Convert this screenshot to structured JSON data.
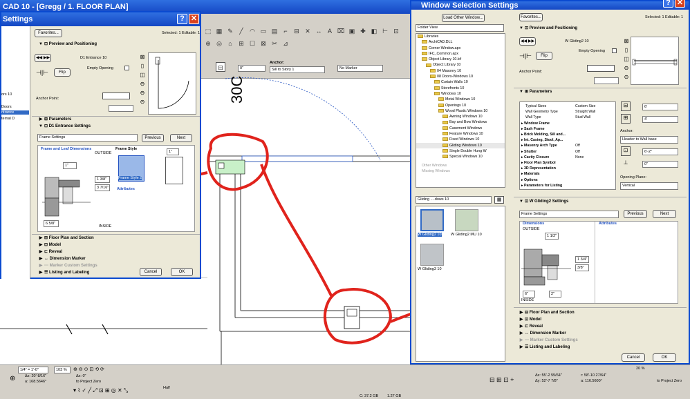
{
  "app": {
    "title": "CAD 10 - [Gregg / 1. FLOOR PLAN]"
  },
  "canvas": {
    "dimension_text": "30C"
  },
  "toolbar": {
    "anchor_label": "Anchor:",
    "anchor_value": "Sill to Story 1",
    "offset_value": "0\"",
    "marker_value": "No Marker"
  },
  "left_dialog": {
    "title": "Settings",
    "favorites": "Favorites...",
    "selected": "Selected: 1 Editable: 1",
    "preview_section": "Preview and Positioning",
    "object_name": "D1 Entrance 10",
    "empty_opening": "Empty Opening",
    "flip": "Flip",
    "anchor_point": "Anchor Point:",
    "parameters": "Parameters",
    "settings_section": "D1 Entrance Settings",
    "frame_settings": "Frame Settings",
    "previous": "Previous",
    "next": "Next",
    "frame_leaf_dims": "Frame and Leaf Dimensions",
    "outside": "OUTSIDE",
    "inside": "INSIDE",
    "frame_style": "Frame Style",
    "frame_style_value": "Frame Style 2",
    "attributes": "Attributes",
    "dims": {
      "d1": "1\"",
      "d2": "1 3/8\"",
      "d3": "3 7/16\"",
      "d4": "6 5/8\"",
      "d5": "1\""
    },
    "sections": [
      "Floor Plan and Section",
      "Model",
      "Reveal",
      "Dimension Marker",
      "Marker Custom Settings",
      "Listing and Labeling"
    ],
    "cancel": "Cancel",
    "ok": "OK",
    "sidebar": [
      "ors 10",
      "Doors",
      "ntrance",
      "ternal D"
    ]
  },
  "right_dialog": {
    "title": "Window Selection Settings",
    "favorites": "Favorites...",
    "selected": "Selected: 1 Editable: 1",
    "load_other": "Load Other Window...",
    "folder_view": "Folder View",
    "tree": [
      {
        "label": "Libraries",
        "depth": 0
      },
      {
        "label": "ArchiCAD.DLL",
        "depth": 1
      },
      {
        "label": "Corner Window.apx",
        "depth": 1
      },
      {
        "label": "IFC_Common.apx",
        "depth": 1
      },
      {
        "label": "Object Library 10.lcf",
        "depth": 1
      },
      {
        "label": "Object Library 10",
        "depth": 2
      },
      {
        "label": "04 Masonry 10",
        "depth": 3
      },
      {
        "label": "08 Doors-Windows 10",
        "depth": 3
      },
      {
        "label": "Curtain Walls 10",
        "depth": 4
      },
      {
        "label": "Storefronts 10",
        "depth": 4
      },
      {
        "label": "Windows 10",
        "depth": 4
      },
      {
        "label": "Metal Windows 10",
        "depth": 5
      },
      {
        "label": "Openings 10",
        "depth": 5
      },
      {
        "label": "Wood Plastic Windows 10",
        "depth": 5
      },
      {
        "label": "Awning Windows 10",
        "depth": 6
      },
      {
        "label": "Bay and Bow Windows",
        "depth": 6
      },
      {
        "label": "Casement Windows",
        "depth": 6
      },
      {
        "label": "Feature Windows 10",
        "depth": 6
      },
      {
        "label": "Fixed Windows 10",
        "depth": 6
      },
      {
        "label": "Gliding Windows 10",
        "depth": 6
      },
      {
        "label": "Single Double Hung W",
        "depth": 6
      },
      {
        "label": "Special Windows 10",
        "depth": 6
      }
    ],
    "other_windows": "Other Windows",
    "missing_windows": "Missing Windows",
    "gallery_folder": "Gliding ....dows 10",
    "thumbs": [
      "W Gliding2 10",
      "W Gliding2 MU 10",
      "W Gliding3 10"
    ],
    "preview_section": "Preview and Positioning",
    "object_name": "W Gliding2 10",
    "empty_opening": "Empty Opening",
    "flip": "Flip",
    "anchor_point": "Anchor Point:",
    "parameters_section": "Parameters",
    "params": [
      {
        "k": "Typical Sizes",
        "v": "Custom Size"
      },
      {
        "k": "Wall Geometry Type",
        "v": "Straight Wall"
      },
      {
        "k": "Wall Type",
        "v": "Stud Wall"
      },
      {
        "k": "Window Frame",
        "v": "",
        "b": true
      },
      {
        "k": "Sash Frame",
        "v": "",
        "b": true
      },
      {
        "k": "Brick Molding, Sill and...",
        "v": "",
        "b": true
      },
      {
        "k": "Int. Casing, Stool, Ap...",
        "v": "",
        "b": true
      },
      {
        "k": "Masonry Arch Type",
        "v": "Off",
        "b": true
      },
      {
        "k": "Shutter",
        "v": "Off",
        "b": true
      },
      {
        "k": "Cavity Closure",
        "v": "None",
        "b": true
      },
      {
        "k": "Floor Plan Symbol",
        "v": "",
        "b": true
      },
      {
        "k": "3D Representation",
        "v": "",
        "b": true
      },
      {
        "k": "Materials",
        "v": "",
        "b": true
      },
      {
        "k": "Options",
        "v": "",
        "b": true
      },
      {
        "k": "Parameters for Listing",
        "v": "",
        "b": true
      }
    ],
    "width_val": "6'",
    "height_val": "4'",
    "anchor_label": "Anchor:",
    "anchor_value": "Header to Wall base",
    "sill_val": "6'-2\"",
    "offset_val": "0\"",
    "opening_plane_label": "Opening Plane:",
    "opening_plane_value": "Vertical",
    "settings_section": "W Gliding2 Settings",
    "frame_settings": "Frame Settings",
    "previous": "Previous",
    "next": "Next",
    "dimensions": "Dimensions",
    "attributes": "Attributes",
    "outside": "OUTSIDE",
    "inside": "INSIDE",
    "dims": {
      "d1": "1 1/2\"",
      "d2": "1 3/4\"",
      "d3": "3/8\"",
      "d4": "6\"",
      "d5": "2\""
    },
    "sections": [
      "Floor Plan and Section",
      "Model",
      "Reveal",
      "Dimension Marker",
      "Marker Custom Settings",
      "Listing and Labeling"
    ],
    "cancel": "Cancel",
    "ok": "OK"
  },
  "statusbar": {
    "scale": "1/4\" = 1'-0\"",
    "zoom": "103 %",
    "coords_dx": "Δx: 20'-8/16\"",
    "coords_a": "a: 168.5646°",
    "to_zero": "to Project Zero",
    "coords_r_dx": "Δx: 0\"",
    "coords_r_dy": "Δy: 0\"",
    "half": "Half",
    "right_dx": "Δx: 55'-2 55/64\"",
    "right_dy": "Δy: 52'-7 7/8\"",
    "right_r": "r: 58'-10 27/64\"",
    "right_a": "a: 116.5600°",
    "right_zoom": "20 %",
    "right_to_zero": "to Project Zero",
    "disk": "C: 37.2 GB",
    "mem": "1.27 GB"
  },
  "colors": {
    "title_blue": "#1f5bd6",
    "annotation_red": "#e0231c",
    "dialog_bg": "#ece9d8",
    "selection": "#316ac5"
  }
}
